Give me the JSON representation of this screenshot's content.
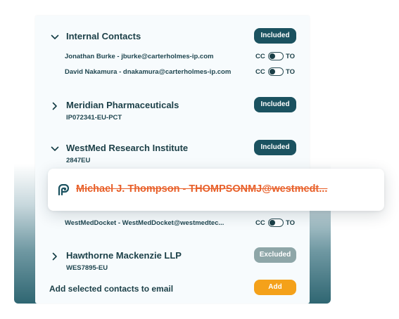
{
  "groups": {
    "internal": {
      "title": "Internal Contacts",
      "badge": "Included",
      "expanded": true,
      "contacts": [
        {
          "text": "Jonathan Burke - jburke@carterholmes-ip.com",
          "cc_label": "CC",
          "to_label": "TO"
        },
        {
          "text": "David Nakamura - dnakamura@carterholmes-ip.com",
          "cc_label": "CC",
          "to_label": "TO"
        }
      ]
    },
    "meridian": {
      "title": "Meridian Pharmaceuticals",
      "subtitle": "IP072341-EU-PCT",
      "badge": "Included",
      "expanded": false
    },
    "westmed": {
      "title": "WestMed Research Institute",
      "subtitle": "2847EU",
      "badge": "Included",
      "expanded": true,
      "contacts": [
        {
          "text": "WestMedDocket -  WestMedDocket@westmedtec...",
          "cc_label": "CC",
          "to_label": "TO"
        }
      ]
    },
    "hawthorne": {
      "title": "Hawthorne Mackenzie LLP",
      "subtitle": "WES7895-EU",
      "badge": "Excluded",
      "expanded": false
    }
  },
  "dragged_contact": {
    "text": "Michael J. Thompson - THOMPSONMJ@westmedt...",
    "icon": "brand-logo-icon"
  },
  "footer": {
    "label": "Add selected contacts to email",
    "add_label": "Add"
  },
  "colors": {
    "badge_included": "#1b5260",
    "badge_excluded": "#8ea6a8",
    "add_button": "#f4a11a",
    "struck_text": "#e8602a",
    "text_dark": "#1b3f47"
  }
}
